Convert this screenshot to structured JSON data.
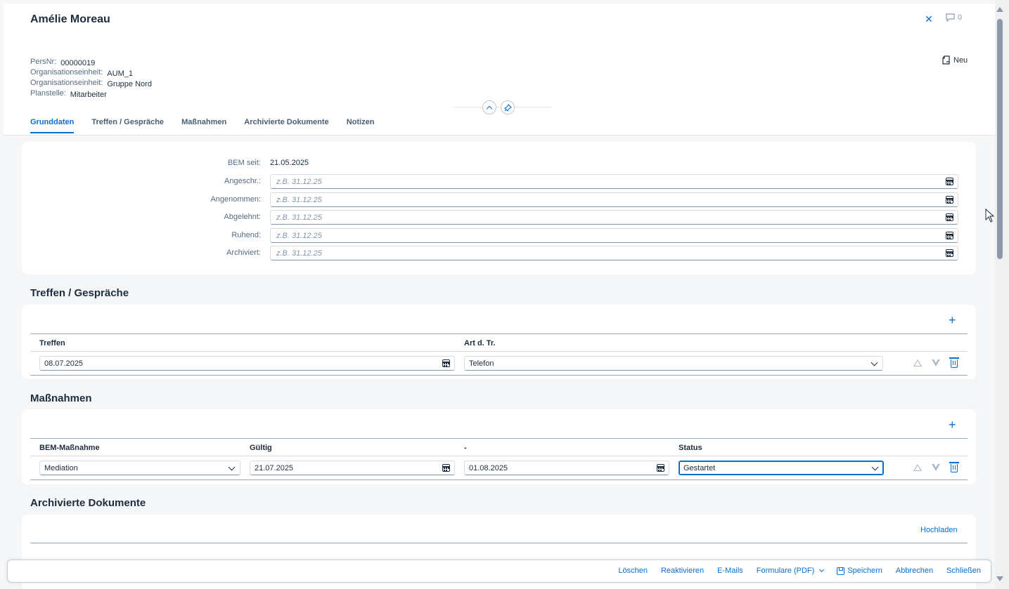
{
  "header": {
    "title": "Amélie Moreau",
    "comment_count": "0",
    "new_label": "Neu",
    "info": [
      {
        "label": "PersNr:",
        "value": "00000019"
      },
      {
        "label": "Organisationseinheit:",
        "value": "AUM_1"
      },
      {
        "label": "Organisationseinheit:",
        "value": "Gruppe Nord"
      },
      {
        "label": "Planstelle:",
        "value": "Mitarbeiter"
      }
    ]
  },
  "tabs": [
    {
      "label": "Grunddaten",
      "active": true
    },
    {
      "label": "Treffen / Gespräche",
      "active": false
    },
    {
      "label": "Maßnahmen",
      "active": false
    },
    {
      "label": "Archivierte Dokumente",
      "active": false
    },
    {
      "label": "Notizen",
      "active": false
    }
  ],
  "grunddaten": {
    "bem_seit_label": "BEM seit:",
    "bem_seit_value": "21.05.2025",
    "date_placeholder": "z.B. 31.12.25",
    "fields": [
      {
        "label": "Angeschr.:"
      },
      {
        "label": "Angenommen:"
      },
      {
        "label": "Abgelehnt:"
      },
      {
        "label": "Ruhend:"
      },
      {
        "label": "Archiviert:"
      }
    ]
  },
  "treffen": {
    "title": "Treffen / Gespräche",
    "columns": [
      "Treffen",
      "Art d. Tr."
    ],
    "rows": [
      {
        "treffen": "08.07.2025",
        "art": "Telefon"
      }
    ]
  },
  "massnahmen": {
    "title": "Maßnahmen",
    "columns": [
      "BEM-Maßnahme",
      "Gültig",
      "-",
      "Status"
    ],
    "rows": [
      {
        "massnahme": "Mediation",
        "gueltig": "21.07.2025",
        "bis": "01.08.2025",
        "status": "Gestartet"
      }
    ]
  },
  "dokumente": {
    "title": "Archivierte Dokumente",
    "upload_label": "Hochladen"
  },
  "footer": {
    "loeschen": "Löschen",
    "reaktivieren": "Reaktivieren",
    "emails": "E-Mails",
    "formulare": "Formulare (PDF)",
    "speichern": "Speichern",
    "abbrechen": "Abbrechen",
    "schliessen": "Schließen"
  },
  "colors": {
    "accent": "#0a6ed1",
    "text": "#1d2d3e",
    "background": "#f5f6f7"
  }
}
